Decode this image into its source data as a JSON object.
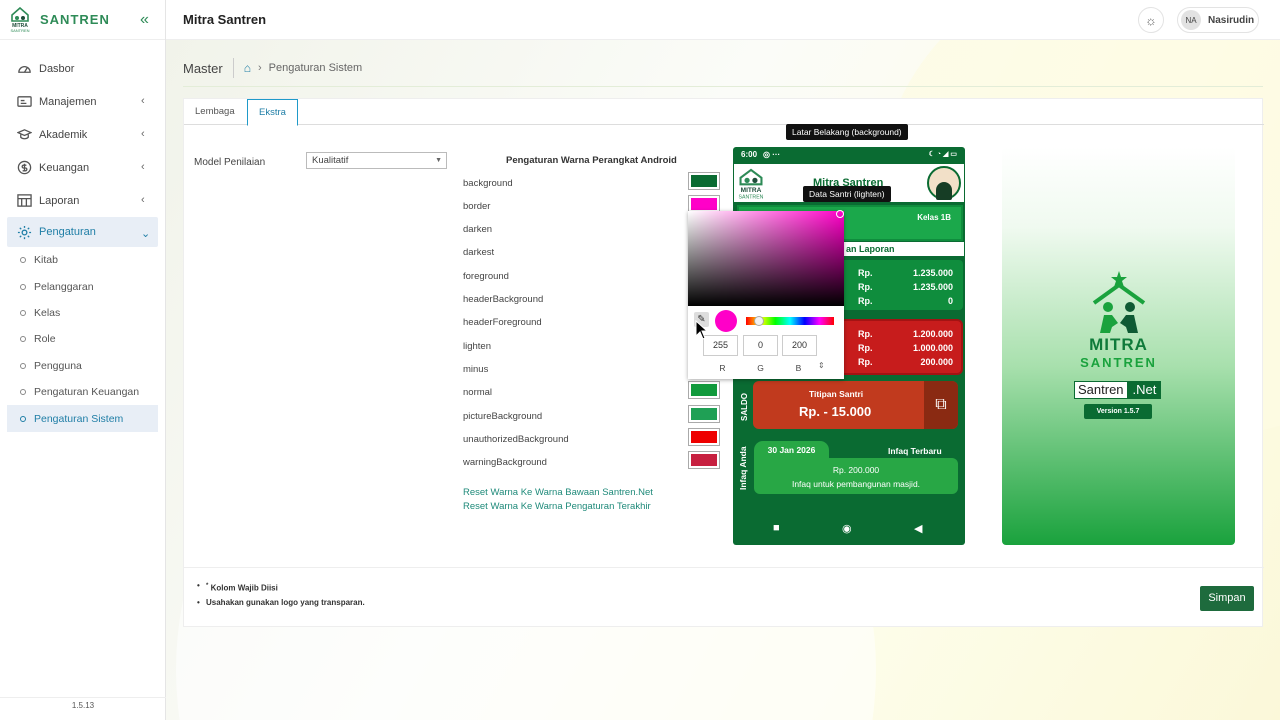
{
  "app": {
    "brand": "SANTREN",
    "title": "Mitra Santren",
    "version": "1.5.13"
  },
  "user": {
    "initials": "NA",
    "name": "Nasirudin"
  },
  "sidebar": {
    "items": [
      {
        "label": "Dasbor"
      },
      {
        "label": "Manajemen"
      },
      {
        "label": "Akademik"
      },
      {
        "label": "Keuangan"
      },
      {
        "label": "Laporan"
      },
      {
        "label": "Pengaturan"
      }
    ],
    "sub": [
      {
        "label": "Kitab"
      },
      {
        "label": "Pelanggaran"
      },
      {
        "label": "Kelas"
      },
      {
        "label": "Role"
      },
      {
        "label": "Pengguna"
      },
      {
        "label": "Pengaturan Keuangan"
      },
      {
        "label": "Pengaturan Sistem"
      }
    ]
  },
  "breadcrumb": {
    "root": "Master",
    "current": "Pengaturan Sistem"
  },
  "tabs": [
    {
      "label": "Lembaga"
    },
    {
      "label": "Ekstra"
    }
  ],
  "form": {
    "model_label": "Model Penilaian",
    "model_value": "Kualitatif"
  },
  "colors": {
    "title": "Pengaturan Warna Perangkat Android",
    "rows": [
      {
        "name": "background",
        "color": "#0a6b32"
      },
      {
        "name": "border",
        "color": "#ff00c8"
      },
      {
        "name": "darken",
        "color": ""
      },
      {
        "name": "darkest",
        "color": ""
      },
      {
        "name": "foreground",
        "color": ""
      },
      {
        "name": "headerBackground",
        "color": ""
      },
      {
        "name": "headerForeground",
        "color": ""
      },
      {
        "name": "lighten",
        "color": ""
      },
      {
        "name": "minus",
        "color": ""
      },
      {
        "name": "normal",
        "color": "#119a3c"
      },
      {
        "name": "pictureBackground",
        "color": "#1fa055"
      },
      {
        "name": "unauthorizedBackground",
        "color": "#ee0000"
      },
      {
        "name": "warningBackground",
        "color": "#c72040"
      }
    ],
    "reset1": "Reset Warna Ke Warna Bawaan Santren.Net",
    "reset2": "Reset Warna Ke Warna Pengaturan Terakhir"
  },
  "picker": {
    "r": "255",
    "g": "0",
    "b": "200",
    "r_label": "R",
    "g_label": "G",
    "b_label": "B"
  },
  "phone": {
    "time": "6:00",
    "title": "Mitra Santren",
    "kelas": "Kelas 1B",
    "laporan": "an Laporan",
    "rows_green": [
      [
        "Rp.",
        "1.235.000"
      ],
      [
        "Rp.",
        "1.235.000"
      ],
      [
        "Rp.",
        "0"
      ]
    ],
    "rows_red": [
      [
        "Rp.",
        "1.200.000"
      ],
      [
        "Rp.",
        "1.000.000"
      ],
      [
        "Rp.",
        "200.000"
      ]
    ],
    "saldo_label": "SALDO",
    "titipan_title": "Titipan Santri",
    "titipan_value": "Rp. - 15.000",
    "infaq_label": "Infaq Anda",
    "infaq_date": "30 Jan 2026",
    "infaq_title": "Infaq Terbaru",
    "infaq_amount": "Rp. 200.000",
    "infaq_desc": "Infaq untuk pembangunan masjid."
  },
  "tooltips": {
    "bg": "Latar Belakang (background)",
    "lighten": "Data Santri (lighten)"
  },
  "splash": {
    "mitra": "MITRA",
    "santren": "SANTREN",
    "net_a": "Santren",
    "net_b": ".Net",
    "version": "Version 1.5.7"
  },
  "notes": [
    "Kolom Wajib Diisi",
    "Usahakan gunakan logo yang transparan."
  ],
  "save_label": "Simpan"
}
